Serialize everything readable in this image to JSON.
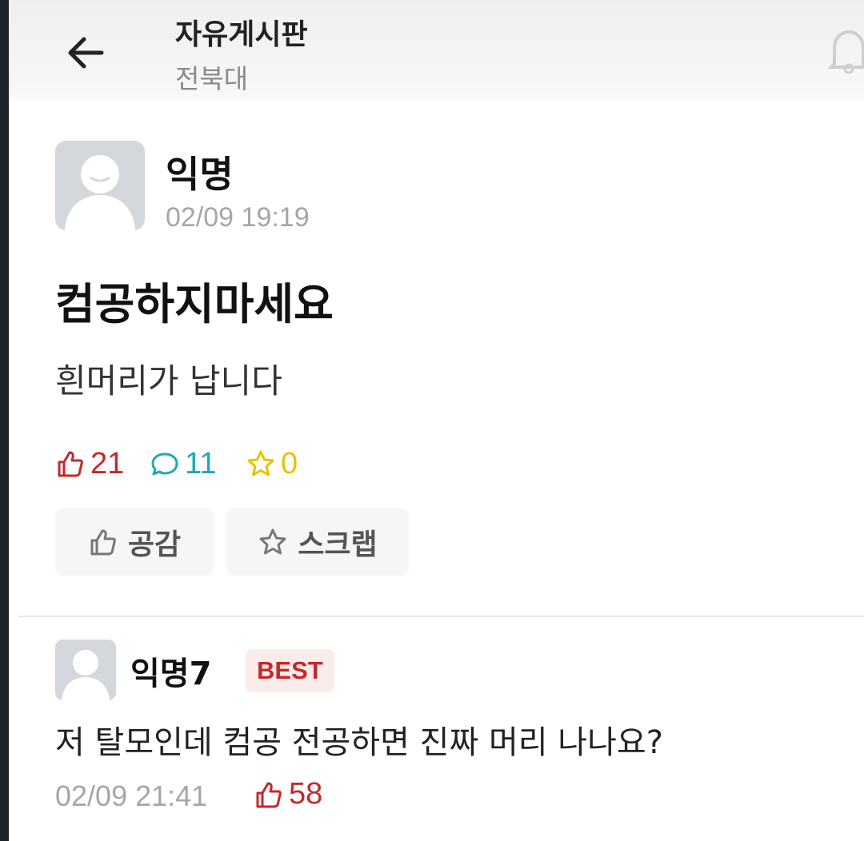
{
  "header": {
    "title": "자유게시판",
    "subtitle": "전북대",
    "back_icon": "arrow-left-icon",
    "bell_icon": "bell-icon"
  },
  "post": {
    "author": "익명",
    "time": "02/09 19:19",
    "title": "컴공하지마세요",
    "body": "흰머리가 납니다",
    "likes": "21",
    "comments": "11",
    "scraps": "0"
  },
  "actions": {
    "like_label": "공감",
    "scrap_label": "스크랩"
  },
  "comment": {
    "author": "익명7",
    "badge": "BEST",
    "text": "저 탈모인데 컴공 전공하면 진짜 머리 나나요?",
    "time": "02/09 21:41",
    "likes": "58"
  },
  "colors": {
    "like": "#c62828",
    "comment": "#1fa8b4",
    "scrap": "#e8c200",
    "avatar_bg": "#d4d7db"
  }
}
